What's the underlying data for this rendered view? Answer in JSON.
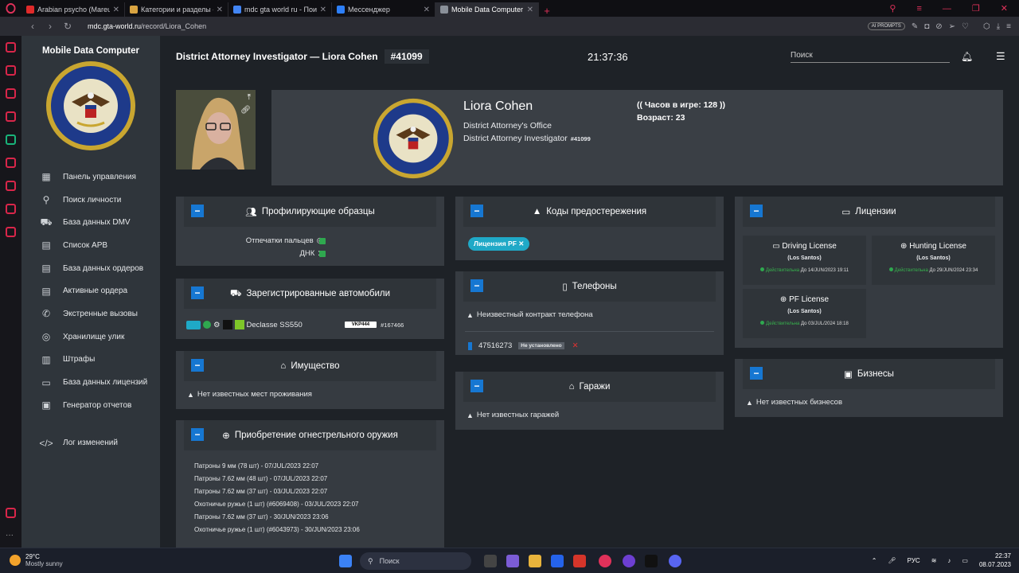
{
  "browser": {
    "tabs": [
      {
        "title": "Arabian psycho (Mareux - Th",
        "favicon_color": "#e02a2a"
      },
      {
        "title": "Категории и разделы - GTA",
        "favicon_color": "#d9a441"
      },
      {
        "title": "mdc gta world ru - Поиск в",
        "favicon_color": "#4285f4"
      },
      {
        "title": "Мессенджер",
        "favicon_color": "#2d7ff9"
      },
      {
        "title": "Mobile Data Computer - GTA",
        "favicon_color": "#8a9099",
        "active": true
      }
    ],
    "url_host": "mdc.gta-world.ru",
    "url_path": "/record/Liora_Cohen",
    "ai_prompts": "AI PROMPTS"
  },
  "sidebar": {
    "title": "Mobile Data Computer",
    "items": [
      {
        "label": "Панель управления",
        "icon": "dashboard-icon",
        "glyph": "▦"
      },
      {
        "label": "Поиск личности",
        "icon": "search-icon",
        "glyph": "⚲"
      },
      {
        "label": "База данных DMV",
        "icon": "car-icon",
        "glyph": "⛟"
      },
      {
        "label": "Список APB",
        "icon": "clipboard-icon",
        "glyph": "▤"
      },
      {
        "label": "База данных ордеров",
        "icon": "warrant-icon",
        "glyph": "▤"
      },
      {
        "label": "Активные ордера",
        "icon": "active-warrant-icon",
        "glyph": "▤"
      },
      {
        "label": "Экстренные вызовы",
        "icon": "phone-icon",
        "glyph": "✆"
      },
      {
        "label": "Хранилище улик",
        "icon": "fingerprint-icon",
        "glyph": "◎"
      },
      {
        "label": "Штрафы",
        "icon": "fine-icon",
        "glyph": "▥"
      },
      {
        "label": "База данных лицензий",
        "icon": "license-icon",
        "glyph": "▭"
      },
      {
        "label": "Генератор отчетов",
        "icon": "report-icon",
        "glyph": "▣"
      }
    ],
    "changelog": {
      "label": "Лог изменений",
      "icon": "code-icon",
      "glyph": "</>"
    }
  },
  "header": {
    "title": "District Attorney Investigator — Liora Cohen",
    "id": "#41099",
    "clock": "21:37:36",
    "search_placeholder": "Поиск"
  },
  "profile": {
    "name": "Liora Cohen",
    "org": "District Attorney's Office",
    "rank": "District Attorney Investigator",
    "rank_id": "#41099",
    "hours": "(( Часов в игре: 128 ))",
    "age": "Возраст: 23"
  },
  "profiling": {
    "title": "Профилирующие образцы",
    "fingerprints": "Отпечатки пальцев",
    "dna": "ДНК"
  },
  "vehicles": {
    "title": "Зарегистрированные автомобили",
    "items": [
      {
        "model": "Declasse SS550",
        "plate": "VKP444",
        "id": "167466",
        "color": "#7ec629"
      }
    ]
  },
  "property": {
    "title": "Имущество",
    "empty": "Нет известных мест проживания"
  },
  "guns": {
    "title": "Приобретение огнестрельного оружия",
    "items": [
      "Патроны 9 мм (78 шт) - 07/JUL/2023 22:07",
      "Патроны 7.62 мм (48 шт) - 07/JUL/2023 22:07",
      "Патроны 7.62 мм (37 шт) - 03/JUL/2023 22:07",
      "Охотничье ружье (1 шт) (#6069408) - 03/JUL/2023 22:07",
      "Патроны 7.62 мм (37 шт) - 30/JUN/2023 23:06",
      "Охотничье ружье (1 шт) (#6043973) - 30/JUN/2023 23:06"
    ]
  },
  "warnings": {
    "title": "Коды предостережения",
    "pill": "Лицензия PF"
  },
  "phones": {
    "title": "Телефоны",
    "unknown": "Неизвестный контракт телефона",
    "number": "47516273",
    "status": "Не установлено"
  },
  "garages": {
    "title": "Гаражи",
    "empty": "Нет известных гаражей"
  },
  "licenses": {
    "title": "Лицензии",
    "items": [
      {
        "name": "Driving License",
        "city": "(Los Santos)",
        "valid": "Действительна",
        "until": "До 14/JUN/2023 19:11"
      },
      {
        "name": "Hunting License",
        "city": "(Los Santos)",
        "valid": "Действительна",
        "until": "До 29/JUN/2024 23:34"
      },
      {
        "name": "PF License",
        "city": "(Los Santos)",
        "valid": "Действительна",
        "until": "До 03/JUL/2024 18:18"
      }
    ]
  },
  "business": {
    "title": "Бизнесы",
    "empty": "Нет известных бизнесов"
  },
  "taskbar": {
    "temp": "29°C",
    "weather": "Mostly sunny",
    "search": "Поиск",
    "lang": "РУС",
    "time": "22:37",
    "date": "08.07.2023"
  }
}
